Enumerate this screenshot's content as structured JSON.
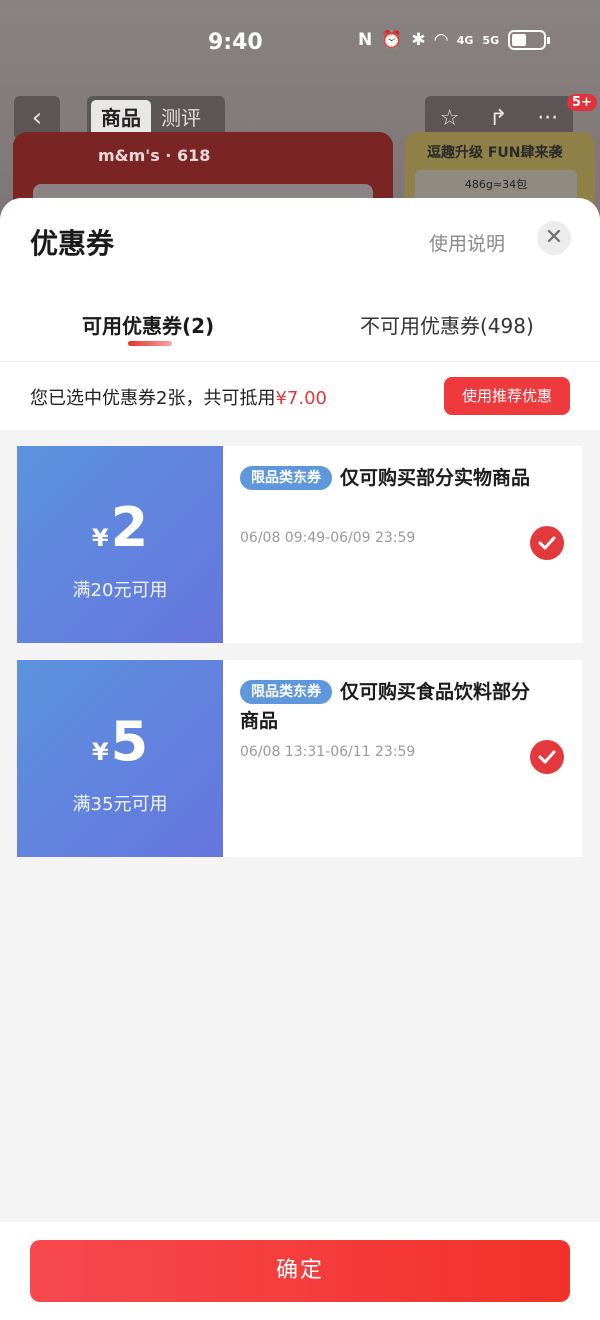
{
  "status_bar": {
    "time": "9:40",
    "signal_4g": "4G",
    "signal_5g": "5G"
  },
  "background_page": {
    "tabs": [
      "商品",
      "测评"
    ],
    "badge": "5+",
    "promo_right_title": "逗趣升级 FUN肆来袭",
    "promo_right_spec": "486g≈34包"
  },
  "sheet": {
    "title": "优惠券",
    "usage_link": "使用说明",
    "tabs": [
      {
        "label": "可用优惠券(2)"
      },
      {
        "label": "不可用优惠券(498)"
      }
    ],
    "summary": {
      "prefix": "您已选中优惠券2张，共可抵用",
      "amount": "¥7.00"
    },
    "recommend_button": "使用推荐优惠",
    "coupons": [
      {
        "currency": "¥",
        "amount": "2",
        "condition": "满20元可用",
        "tag": "限品类东券",
        "title": "仅可购买部分实物商品",
        "time": "06/08 09:49-06/09 23:59",
        "selected": true
      },
      {
        "currency": "¥",
        "amount": "5",
        "condition": "满35元可用",
        "tag": "限品类东券",
        "title": "仅可购买食品饮料部分商品",
        "time": "06/08 13:31-06/11 23:59",
        "selected": true
      }
    ],
    "confirm_button": "确定"
  }
}
